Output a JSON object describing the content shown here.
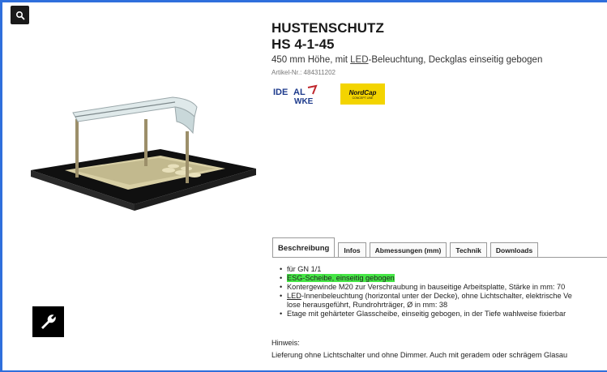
{
  "product": {
    "title": "HUSTENSCHUTZ",
    "model": "HS 4-1-45",
    "subtitle_pre": "450 mm Höhe, mit ",
    "subtitle_link": "LED",
    "subtitle_post": "-Beleuchtung, Deckglas einseitig gebogen",
    "article": "Artikel-Nr.: 484311202"
  },
  "brands": {
    "ideal_lettering": "IDEALWKE",
    "nordcap_name": "NordCap",
    "nordcap_sub": "CONCEPT LINE"
  },
  "tabs": [
    {
      "label": "Beschreibung",
      "active": true
    },
    {
      "label": "Infos",
      "active": false
    },
    {
      "label": "Abmessungen (mm)",
      "active": false
    },
    {
      "label": "Technik",
      "active": false
    },
    {
      "label": "Downloads",
      "active": false
    }
  ],
  "description": {
    "items": [
      "für GN 1/1",
      "ESG-Scheibe, einseitig gebogen",
      "Kontergewinde M20 zur Verschraubung in bauseitige Arbeitsplatte, Stärke in mm: 70"
    ],
    "led_link": "LED",
    "led_text": "-Innenbeleuchtung (horizontal unter der Decke), ohne Lichtschalter, elektrische Ve",
    "led_cont": "lose herausgeführt, Rundrohrträger, Ø in mm: 38",
    "etage": "Etage mit gehärteter Glasscheibe, einseitig gebogen, in der Tiefe wahlweise fixierbar"
  },
  "hint": {
    "label": "Hinweis:",
    "text": "Lieferung ohne Lichtschalter und ohne Dimmer. Auch mit geradem oder schrägem Glasau"
  },
  "colors": {
    "frame": "#2f6fdc",
    "highlight": "#46e646",
    "nordcap_yellow": "#f3d400"
  },
  "icons": [
    "search-icon",
    "wrench-icon"
  ]
}
